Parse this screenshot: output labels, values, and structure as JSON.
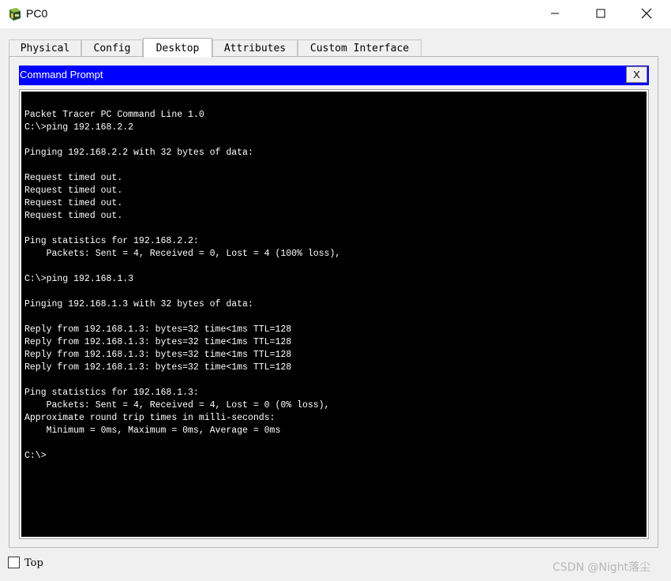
{
  "window": {
    "title": "PC0",
    "app_icon": "packet-tracer-pc-icon",
    "controls": {
      "minimize": "minimize-icon",
      "maximize": "maximize-icon",
      "close": "close-icon"
    }
  },
  "tabs": [
    {
      "label": "Physical",
      "active": false
    },
    {
      "label": "Config",
      "active": false
    },
    {
      "label": "Desktop",
      "active": true
    },
    {
      "label": "Attributes",
      "active": false
    },
    {
      "label": "Custom Interface",
      "active": false
    }
  ],
  "command_prompt": {
    "title": "Command Prompt",
    "close_label": "X",
    "header_color": "#0000ff",
    "lines": [
      "Packet Tracer PC Command Line 1.0",
      "C:\\>ping 192.168.2.2",
      "",
      "Pinging 192.168.2.2 with 32 bytes of data:",
      "",
      "Request timed out.",
      "Request timed out.",
      "Request timed out.",
      "Request timed out.",
      "",
      "Ping statistics for 192.168.2.2:",
      "    Packets: Sent = 4, Received = 0, Lost = 4 (100% loss),",
      "",
      "C:\\>ping 192.168.1.3",
      "",
      "Pinging 192.168.1.3 with 32 bytes of data:",
      "",
      "Reply from 192.168.1.3: bytes=32 time<1ms TTL=128",
      "Reply from 192.168.1.3: bytes=32 time<1ms TTL=128",
      "Reply from 192.168.1.3: bytes=32 time<1ms TTL=128",
      "Reply from 192.168.1.3: bytes=32 time<1ms TTL=128",
      "",
      "Ping statistics for 192.168.1.3:",
      "    Packets: Sent = 4, Received = 4, Lost = 0 (0% loss),",
      "Approximate round trip times in milli-seconds:",
      "    Minimum = 0ms, Maximum = 0ms, Average = 0ms",
      "",
      "C:\\>"
    ]
  },
  "footer": {
    "top_label": "Top",
    "top_checked": false,
    "watermark": "CSDN @Night落尘"
  }
}
